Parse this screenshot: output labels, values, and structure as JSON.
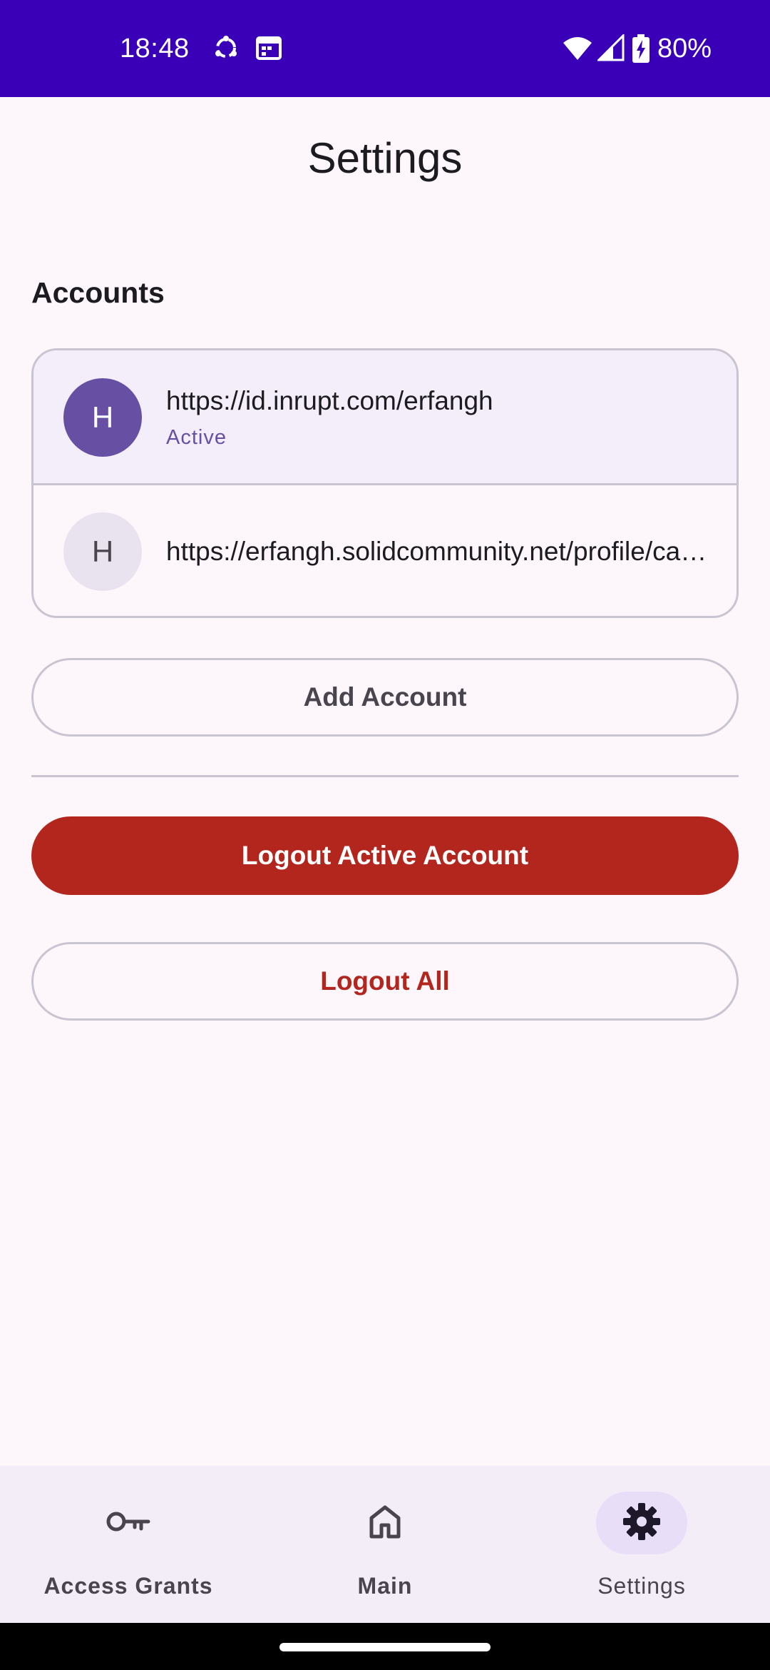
{
  "status_bar": {
    "time": "18:48",
    "battery_percent": "80%",
    "icons": [
      "sync-icon",
      "calendar-icon",
      "wifi-icon",
      "signal-icon",
      "battery-charging-icon"
    ]
  },
  "page": {
    "title": "Settings"
  },
  "accounts": {
    "section_title": "Accounts",
    "items": [
      {
        "avatar_letter": "H",
        "url": "https://id.inrupt.com/erfangh",
        "status": "Active"
      },
      {
        "avatar_letter": "H",
        "url": "https://erfangh.solidcommunity.net/profile/card#me",
        "status": ""
      }
    ]
  },
  "actions": {
    "add_account": "Add Account",
    "logout_active": "Logout Active Account",
    "logout_all": "Logout All"
  },
  "bottom_nav": {
    "items": [
      {
        "label": "Access Grants",
        "icon": "key-icon",
        "selected": false
      },
      {
        "label": "Main",
        "icon": "home-icon",
        "selected": false
      },
      {
        "label": "Settings",
        "icon": "gear-icon",
        "selected": true
      }
    ]
  },
  "colors": {
    "status_bar": "#3a00b8",
    "primary": "#6750a4",
    "danger": "#b3261e",
    "background": "#fdf7fc",
    "nav_background": "#f3edf7",
    "nav_indicator": "#e8def8"
  }
}
